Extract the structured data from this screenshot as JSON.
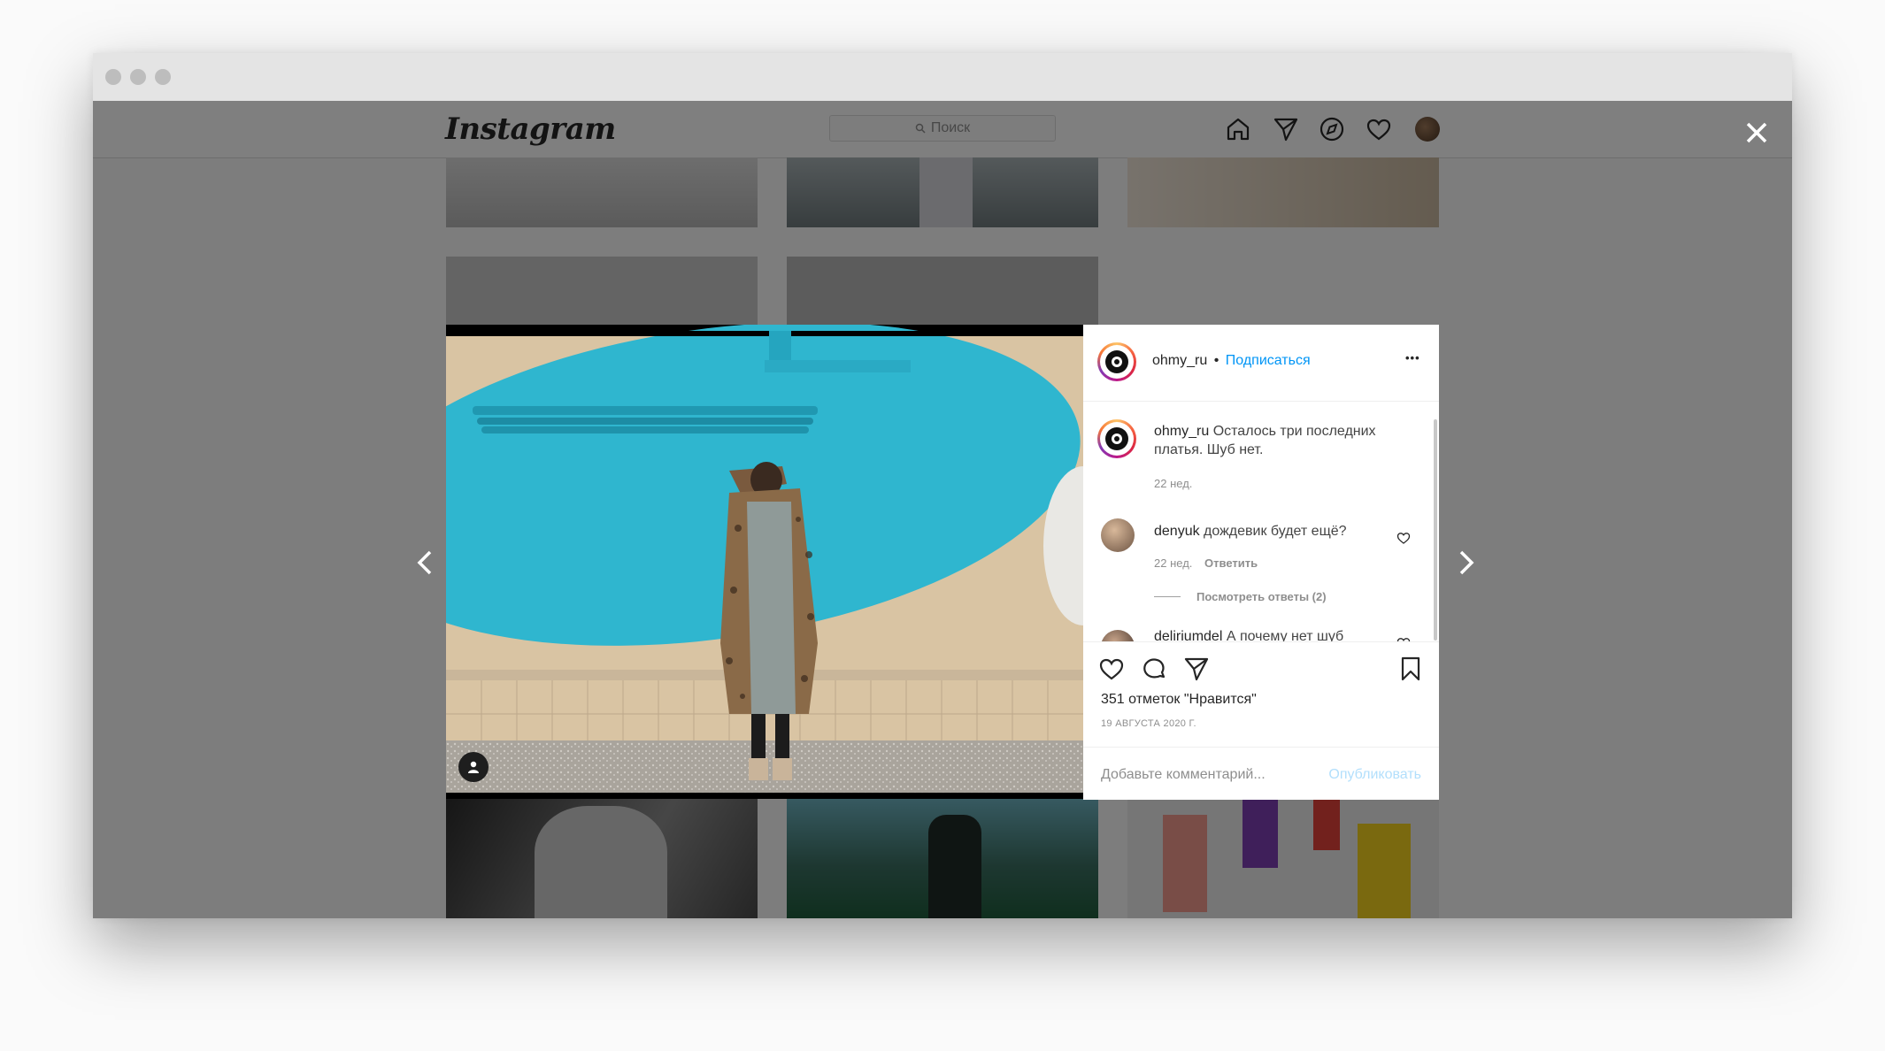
{
  "app": {
    "logo": "Instagram",
    "search_placeholder": "Поиск"
  },
  "nav": {
    "icons": [
      "home-icon",
      "direct-icon",
      "explore-icon",
      "activity-heart-icon",
      "profile-avatar"
    ]
  },
  "post": {
    "username": "ohmy_ru",
    "separator": "•",
    "follow_label": "Подписаться",
    "more_label": "•••",
    "caption": {
      "username": "ohmy_ru",
      "text": "Осталось три последних платья. Шуб нет.",
      "time": "22 нед."
    },
    "comments": [
      {
        "username": "denyuk",
        "text": "дождевик будет ещё?",
        "time": "22 нед.",
        "reply_label": "Ответить",
        "view_replies": "Посмотреть ответы (2)"
      },
      {
        "username": "deliriumdel",
        "text": "А почему нет шуб"
      }
    ],
    "likes_text": "351 отметок \"Нравится\"",
    "date": "19 АВГУСТА 2020 Г.",
    "comment_placeholder": "Добавьте комментарий...",
    "publish_label": "Опубликовать"
  },
  "colors": {
    "accent": "#0095f6",
    "overlay": "rgba(0,0,0,0.5)",
    "wall_blue": "#2fb6cf",
    "wall_beige": "#d9c4a3"
  }
}
